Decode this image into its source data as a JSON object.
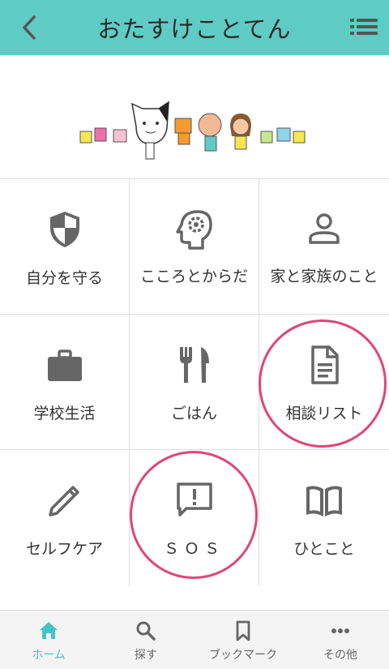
{
  "header": {
    "title": "おたすけことてん",
    "back_icon": "chevron-left-icon",
    "menu_icon": "list-icon"
  },
  "banner": {
    "image": "mascot-characters-illustration"
  },
  "grid": [
    {
      "label": "自分を守る",
      "icon": "shield-icon"
    },
    {
      "label": "こころとからだ",
      "icon": "head-gear-icon"
    },
    {
      "label": "家と家族のこと",
      "icon": "person-icon"
    },
    {
      "label": "学校生活",
      "icon": "briefcase-icon"
    },
    {
      "label": "ごはん",
      "icon": "fork-knife-icon"
    },
    {
      "label": "相談リスト",
      "icon": "document-icon"
    },
    {
      "label": "セルフケア",
      "icon": "pencil-icon"
    },
    {
      "label": "ＳＯＳ",
      "icon": "alert-bubble-icon"
    },
    {
      "label": "ひとこと",
      "icon": "book-icon"
    }
  ],
  "tabbar": [
    {
      "label": "ホーム",
      "icon": "home-icon",
      "active": true
    },
    {
      "label": "探す",
      "icon": "search-icon",
      "active": false
    },
    {
      "label": "ブックマーク",
      "icon": "bookmark-icon",
      "active": false
    },
    {
      "label": "その他",
      "icon": "more-icon",
      "active": false
    }
  ],
  "colors": {
    "header_bg": "#5fcbc5",
    "active_tab": "#45c4c7",
    "annotation_ring": "#e0457b",
    "icon_gray": "#666666"
  }
}
